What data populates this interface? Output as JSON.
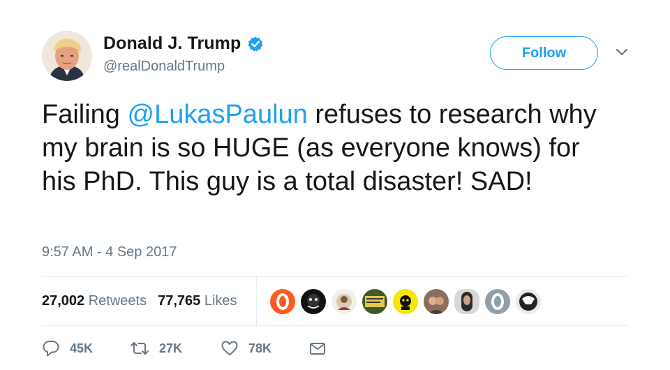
{
  "user": {
    "name": "Donald J. Trump",
    "handle": "@realDonaldTrump",
    "verified": true
  },
  "follow_label": "Follow",
  "tweet": {
    "text_before": "Failing ",
    "mention": "@LukasPaulun",
    "text_after": " refuses to research why my brain is so HUGE (as everyone knows) for his PhD. This guy is a total disaster! SAD!"
  },
  "timestamp": "9:57 AM - 4 Sep 2017",
  "stats": {
    "retweets_count": "27,002",
    "retweets_label": "Retweets",
    "likes_count": "77,765",
    "likes_label": "Likes"
  },
  "actions": {
    "replies": "45K",
    "retweets": "27K",
    "likes": "78K"
  },
  "colors": {
    "accent": "#1da1f2",
    "muted": "#657786",
    "text": "#14171a"
  }
}
